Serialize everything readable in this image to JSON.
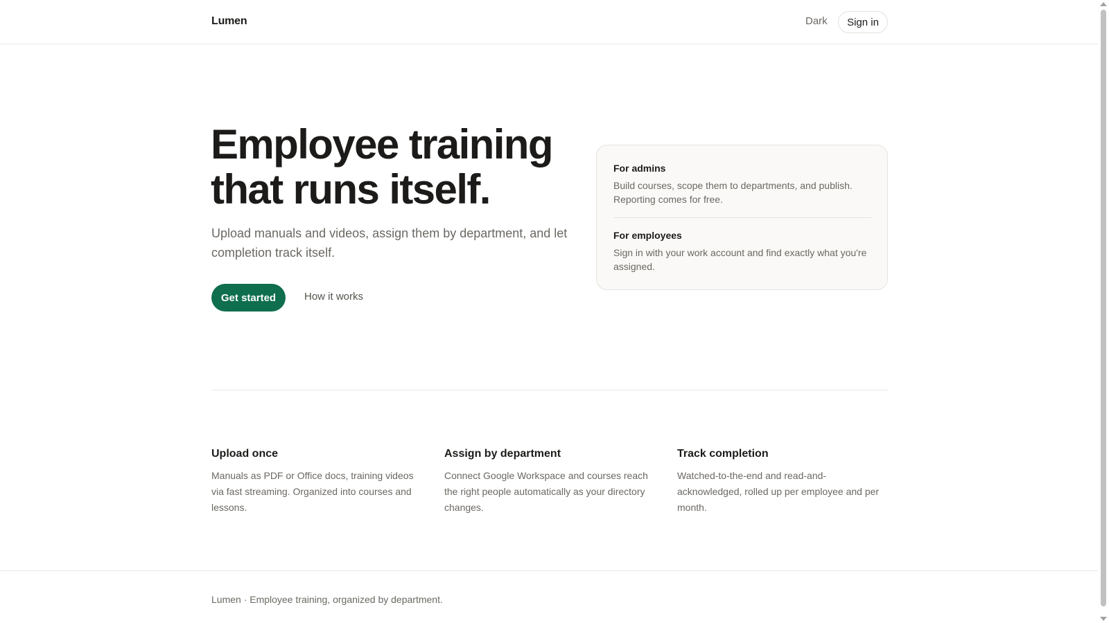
{
  "header": {
    "logo": "Lumen",
    "theme_toggle": "Dark",
    "sign_in": "Sign in"
  },
  "hero": {
    "title_line1": "Employee training",
    "title_line2": "that runs itself.",
    "subtitle": "Upload manuals and videos, assign them by department, and let completion track itself.",
    "primary_cta": "Get started",
    "secondary_cta": "How it works"
  },
  "audience": {
    "admins": {
      "heading": "For admins",
      "text": "Build courses, scope them to departments, and publish. Reporting comes for free."
    },
    "employees": {
      "heading": "For employees",
      "text": "Sign in with your work account and find exactly what you're assigned."
    }
  },
  "features": [
    {
      "title": "Upload once",
      "text": "Manuals as PDF or Office docs, training videos via fast streaming. Organized into courses and lessons."
    },
    {
      "title": "Assign by department",
      "text": "Connect Google Workspace and courses reach the right people automatically as your directory changes."
    },
    {
      "title": "Track completion",
      "text": "Watched-to-the-end and read-and-acknowledged, rolled up per employee and per month."
    }
  ],
  "footer": {
    "text": "Lumen · Employee training, organized by department."
  },
  "colors": {
    "accent": "#0f6e4e",
    "text": "#1c1b19",
    "muted": "#6b6862",
    "card_bg": "#faf9f7"
  }
}
